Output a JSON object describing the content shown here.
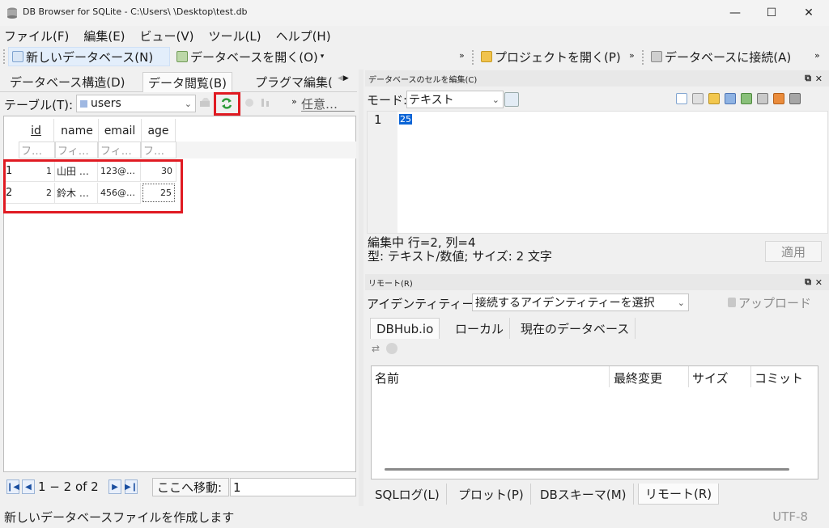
{
  "window": {
    "title": "DB Browser for SQLite - C:\\Users\\        \\Desktop\\test.db",
    "minimize": "—",
    "maximize": "☐",
    "close": "✕"
  },
  "menu": [
    "ファイル(F)",
    "編集(E)",
    "ビュー(V)",
    "ツール(L)",
    "ヘルプ(H)"
  ],
  "toolbar": {
    "new_db": "新しいデータベース(N)",
    "open_db": "データベースを開く(O)",
    "open_db_arrow": "▾",
    "overflow1": "»",
    "open_project": "プロジェクトを開く(P)",
    "overflow2": "»",
    "connect_db": "データベースに接続(A)",
    "overflow3": "»"
  },
  "left_tabs": {
    "structure": "データベース構造(D)",
    "browse": "データ閲覧(B)",
    "pragma": "プラグマ編集(",
    "scroll_left": "◀",
    "scroll_right": "▶"
  },
  "browse": {
    "table_label": "テーブル(T):",
    "table_name": "users",
    "combo_arrow": "⌄",
    "overflow": "»",
    "filter_any": "任意…",
    "columns": [
      "id",
      "name",
      "email",
      "age"
    ],
    "filter_placeholders": [
      "フ…",
      "フィ…",
      "フィ…",
      "フ…"
    ],
    "rows": [
      {
        "num": "1",
        "id": "1",
        "name": "山田 …",
        "email": "123@…",
        "age": "30"
      },
      {
        "num": "2",
        "id": "2",
        "name": "鈴木 …",
        "email": "456@…",
        "age": "25"
      }
    ],
    "pager": "1 − 2 of 2",
    "goto_label": "ここへ移動:",
    "goto_value": "1"
  },
  "cell_editor": {
    "title": "データベースのセルを編集(C)",
    "float_icon": "⧉",
    "close_icon": "✕",
    "mode_label": "モード:",
    "mode_value": "テキスト",
    "mode_arrow": "⌄",
    "line_number": "1",
    "cell_value": "25",
    "status_line1": "編集中 行=2, 列=4",
    "status_line2": "型: テキスト/数値; サイズ: 2 文字",
    "apply": "適用"
  },
  "remote": {
    "title": "リモート(R)",
    "float_icon": "⧉",
    "close_icon": "✕",
    "identity_label": "アイデンティティー",
    "identity_value": "接続するアイデンティティーを選択",
    "identity_arrow": "⌄",
    "upload": "アップロード",
    "tabs": [
      "DBHub.io",
      "ローカル",
      "現在のデータベース"
    ],
    "columns": [
      "名前",
      "最終変更",
      "サイズ",
      "コミット"
    ]
  },
  "bottom_tabs": [
    "SQLログ(L)",
    "プロット(P)",
    "DBスキーマ(M)",
    "リモート(R)"
  ],
  "status": {
    "message": "新しいデータベースファイルを作成します",
    "encoding": "UTF-8"
  },
  "colors": {
    "highlight_red": "#e01a22",
    "selection_blue": "#0a64d6",
    "refresh_green": "#2e9b3a"
  }
}
